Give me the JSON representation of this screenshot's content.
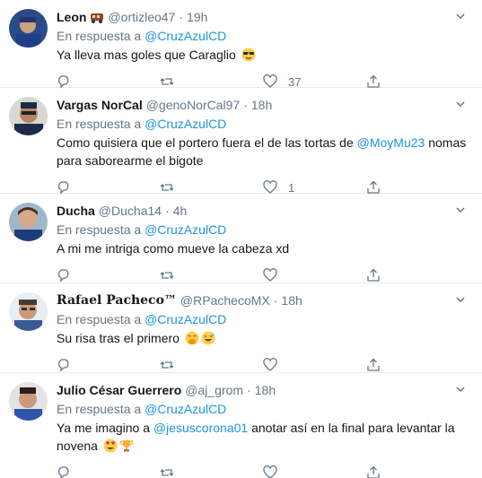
{
  "reply_prefix": "En respuesta a",
  "tweets": [
    {
      "name": "Leon",
      "handle": "@ortizleo47",
      "time": "19h",
      "reply_to": "@CruzAzulCD",
      "text_parts": [
        "Ya lleva mas goles que Caraglio"
      ],
      "likes": "37",
      "name_icon": "train-emoji-icon",
      "emojis": [
        "sunglasses-face-emoji-icon"
      ]
    },
    {
      "name": "Vargas NorCal",
      "handle": "@genoNorCal97",
      "time": "18h",
      "reply_to": "@CruzAzulCD",
      "text_parts": [
        "Como quisiera que el portero fuera el de las tortas de ",
        "@MoyMu23",
        " nomas para saborearme el bigote"
      ],
      "likes": "1",
      "emojis": []
    },
    {
      "name": "Ducha",
      "handle": "@Ducha14",
      "time": "4h",
      "reply_to": "@CruzAzulCD",
      "text_parts": [
        "A mi me intriga como mueve la cabeza xd"
      ],
      "likes": "",
      "emojis": []
    },
    {
      "name": "Rafael Pacheco™",
      "handle": "@RPachecoMX",
      "time": "18h",
      "reply_to": "@CruzAzulCD",
      "text_parts": [
        "Su risa tras el primero "
      ],
      "likes": "",
      "emojis": [
        "hand-over-mouth-emoji-icon",
        "sweat-smile-emoji-icon"
      ]
    },
    {
      "name": "Julio César Guerrero",
      "handle": "@aj_grom",
      "time": "18h",
      "reply_to": "@CruzAzulCD",
      "text_parts": [
        "Ya me imagino a ",
        "@jesuscorona01",
        " anotar así en la final para levantar la novena "
      ],
      "likes": "",
      "emojis": [
        "heart-eyes-emoji-icon",
        "trophy-emoji-icon"
      ]
    }
  ],
  "colors": {
    "link": "#1b95e0",
    "secondary": "#657786",
    "border": "#e6ecf0"
  },
  "icons": [
    "reply-icon",
    "retweet-icon",
    "like-icon",
    "share-icon",
    "caret-down-icon"
  ]
}
